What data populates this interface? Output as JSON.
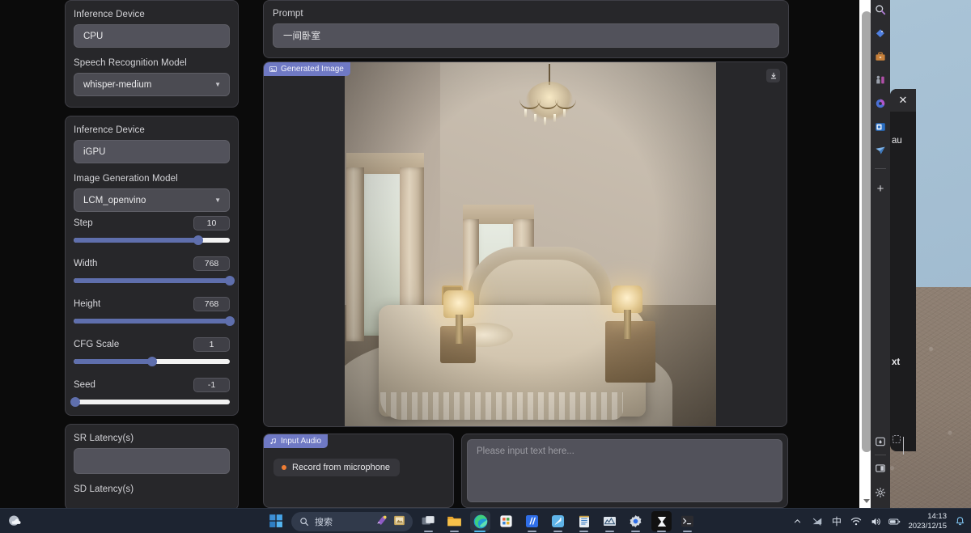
{
  "speech_panel": {
    "device_label": "Inference Device",
    "device_value": "CPU",
    "model_label": "Speech Recognition Model",
    "model_value": "whisper-medium"
  },
  "image_panel": {
    "device_label": "Inference Device",
    "device_value": "iGPU",
    "model_label": "Image Generation Model",
    "model_value": "LCM_openvino",
    "sliders": [
      {
        "label": "Step",
        "value": "10",
        "fill_pct": 80,
        "knob_pct": 80
      },
      {
        "label": "Width",
        "value": "768",
        "fill_pct": 100,
        "knob_pct": 100
      },
      {
        "label": "Height",
        "value": "768",
        "fill_pct": 100,
        "knob_pct": 100
      },
      {
        "label": "CFG Scale",
        "value": "1",
        "fill_pct": 50,
        "knob_pct": 50
      },
      {
        "label": "Seed",
        "value": "-1",
        "fill_pct": 1,
        "knob_pct": 1
      }
    ]
  },
  "latency_panel": {
    "sr_label": "SR Latency(s)",
    "sr_value": "",
    "sd_label": "SD Latency(s)"
  },
  "prompt": {
    "label": "Prompt",
    "value": "一间卧室"
  },
  "generated_image": {
    "chip_label": "Generated Image",
    "chip_icon": "image-icon",
    "download_icon": "download-icon"
  },
  "input_audio": {
    "chip_label": "Input Audio",
    "chip_icon": "music-note-icon",
    "record_label": "Record from microphone"
  },
  "text_input": {
    "placeholder": "Please input text here..."
  },
  "edge_rail": {
    "icons": [
      {
        "name": "search-icon",
        "glyph": "🔍"
      },
      {
        "name": "shopping-tag-icon",
        "glyph": "🏷"
      },
      {
        "name": "briefcase-icon",
        "glyph": "💼"
      },
      {
        "name": "games-icon",
        "glyph": "🎮"
      },
      {
        "name": "copilot-icon",
        "glyph": "◐"
      },
      {
        "name": "outlook-icon",
        "glyph": "📧"
      },
      {
        "name": "paper-plane-icon",
        "glyph": "✈"
      }
    ],
    "add_label": "+",
    "bottom_icons": [
      {
        "name": "browser-essentials-icon"
      },
      {
        "name": "split-screen-icon"
      },
      {
        "name": "settings-gear-icon"
      }
    ]
  },
  "flyout": {
    "close_label": "✕",
    "fragment_top": "au",
    "fragment_mid": "xt"
  },
  "taskbar": {
    "weather_icon": "weather-cloud-icon",
    "start_icon": "windows-start-icon",
    "search_placeholder": "搜索",
    "search_icon": "search-icon",
    "apps": [
      {
        "name": "taskview-icon",
        "active": false
      },
      {
        "name": "file-explorer-icon",
        "active": false
      },
      {
        "name": "microsoft-edge-icon",
        "active": true
      },
      {
        "name": "microsoft-store-icon",
        "active": false
      },
      {
        "name": "media-app-icon",
        "active": false
      },
      {
        "name": "analytics-app-icon",
        "active": false
      },
      {
        "name": "notepad-icon",
        "active": false
      },
      {
        "name": "chart-app-icon",
        "active": false
      },
      {
        "name": "settings-gear-icon",
        "active": false
      },
      {
        "name": "hourglass-app-icon",
        "active": false
      },
      {
        "name": "terminal-icon",
        "active": false
      }
    ],
    "tray": {
      "chevron_icon": "chevron-up-icon",
      "network_icon": "network-icon",
      "ime_label": "中",
      "wifi_icon": "wifi-icon",
      "volume_icon": "volume-icon",
      "battery_icon": "battery-icon",
      "time": "14:13",
      "date": "2023/12/15",
      "notification_icon": "bell-icon"
    }
  },
  "colors": {
    "accent_slider": "#5f6fad",
    "chip_bg": "#6f79c4",
    "panel_bg": "#27272a",
    "field_bg": "#52525b",
    "taskbar_bg": "#1d2431"
  }
}
